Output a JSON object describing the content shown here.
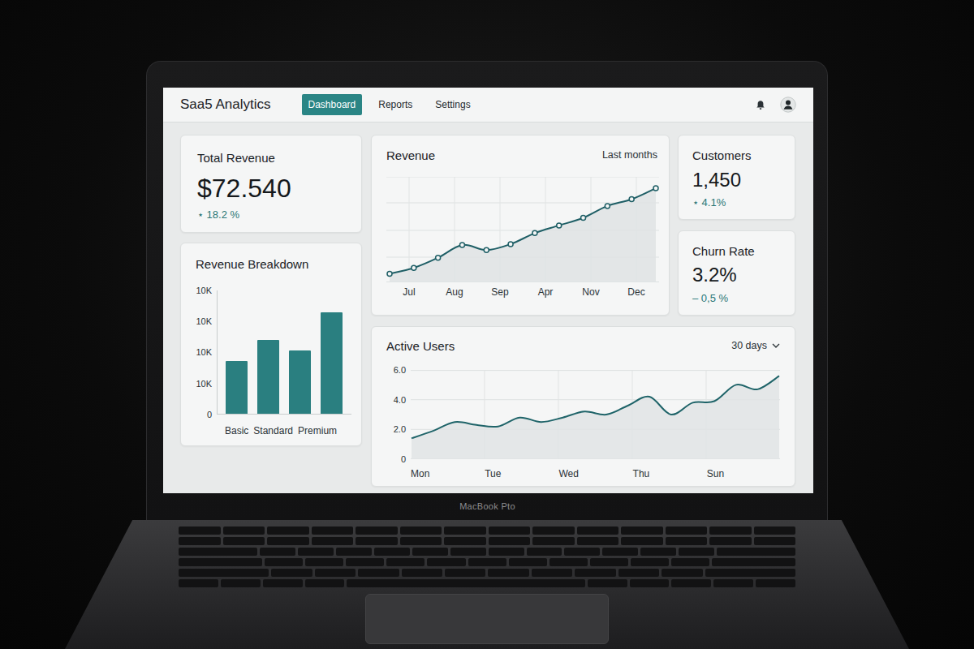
{
  "device": {
    "label": "MacBook Pto"
  },
  "app": {
    "brand": "Saa5 Analytics",
    "nav": [
      {
        "label": "Dashboard",
        "selected": true
      },
      {
        "label": "Reports",
        "selected": false
      },
      {
        "label": "Settings",
        "selected": false
      }
    ]
  },
  "total_revenue": {
    "title": "Total Revenue",
    "value": "$72.540",
    "change": "⋆ 18.2 %"
  },
  "customers": {
    "title": "Customers",
    "value": "1,450",
    "change": "⋆ 4.1%"
  },
  "churn": {
    "title": "Churn Rate",
    "value": "3.2%",
    "change": "– 0,5 %"
  },
  "revenue_chart": {
    "title": "Revenue",
    "range": "Last months",
    "x_labels": [
      "Jul",
      "Aug",
      "Sep",
      "Apr",
      "Nov",
      "Dec"
    ],
    "values": [
      10,
      17,
      29,
      44,
      38,
      45,
      58,
      67,
      76,
      90,
      98,
      111
    ]
  },
  "breakdown": {
    "title": "Revenue Breakdown",
    "y_ticks": [
      "10K",
      "10K",
      "10K",
      "10K",
      "0"
    ],
    "bars": [
      {
        "label": "Basic",
        "value": 17.1
      },
      {
        "label": "Standard",
        "value": 23.7
      },
      {
        "value": 20.3
      },
      {
        "label": "Premium",
        "value": 32.6
      }
    ]
  },
  "active_users": {
    "title": "Active Users",
    "range": "30 days",
    "y_ticks": [
      "6.0",
      "4.0",
      "2.0",
      "0"
    ],
    "x_labels": [
      "Mon",
      "Tue",
      "Wed",
      "Thu",
      "Sun"
    ],
    "values": [
      1.4,
      1.9,
      2.5,
      2.3,
      2.2,
      2.8,
      2.5,
      2.8,
      3.2,
      3.0,
      3.6,
      4.2,
      3.0,
      3.8,
      3.9,
      5.0,
      4.7,
      5.6
    ]
  }
}
